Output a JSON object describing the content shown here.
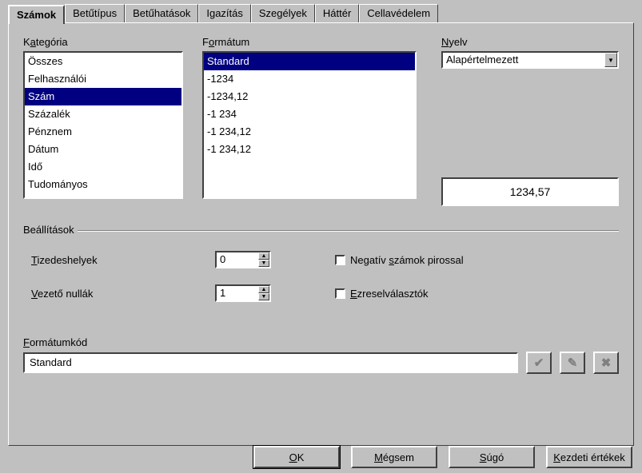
{
  "tabs": {
    "numbers": "Számok",
    "font": "Betűtípus",
    "fonteffects": "Betűhatások",
    "alignment": "Igazítás",
    "borders": "Szegélyek",
    "background": "Háttér",
    "protection": "Cellavédelem"
  },
  "labels": {
    "category_pre": "K",
    "category_u": "a",
    "category_post": "tegória",
    "format_pre": "F",
    "format_u": "o",
    "format_post": "rmátum",
    "language_pre": "",
    "language_u": "N",
    "language_post": "yelv",
    "options": "Beállítások",
    "decimals_pre": "",
    "decimals_u": "T",
    "decimals_post": "izedeshelyek",
    "leading_pre": "",
    "leading_u": "V",
    "leading_post": "ezető nullák",
    "neg_pre": "Negatív ",
    "neg_u": "s",
    "neg_post": "zámok pirossal",
    "thou_pre": "",
    "thou_u": "E",
    "thou_post": "zreselválasztók",
    "fcode_pre": "",
    "fcode_u": "F",
    "fcode_post": "ormátumkód"
  },
  "category": {
    "items": [
      "Összes",
      "Felhasználói",
      "Szám",
      "Százalék",
      "Pénznem",
      "Dátum",
      "Idő",
      "Tudományos"
    ],
    "selected_index": 2
  },
  "format": {
    "items": [
      "Standard",
      "-1234",
      "-1234,12",
      "-1 234",
      "-1 234,12",
      "-1 234,12"
    ],
    "selected_index": 0
  },
  "language": {
    "value": "Alapértelmezett"
  },
  "preview": "1234,57",
  "options": {
    "decimals": "0",
    "leading_zeros": "1"
  },
  "format_code": "Standard",
  "buttons": {
    "ok_pre": "",
    "ok_u": "O",
    "ok_post": "K",
    "cancel_pre": "",
    "cancel_u": "M",
    "cancel_post": "égsem",
    "help_pre": "",
    "help_u": "S",
    "help_post": "úgó",
    "reset_pre": "",
    "reset_u": "K",
    "reset_post": "ezdeti értékek"
  }
}
